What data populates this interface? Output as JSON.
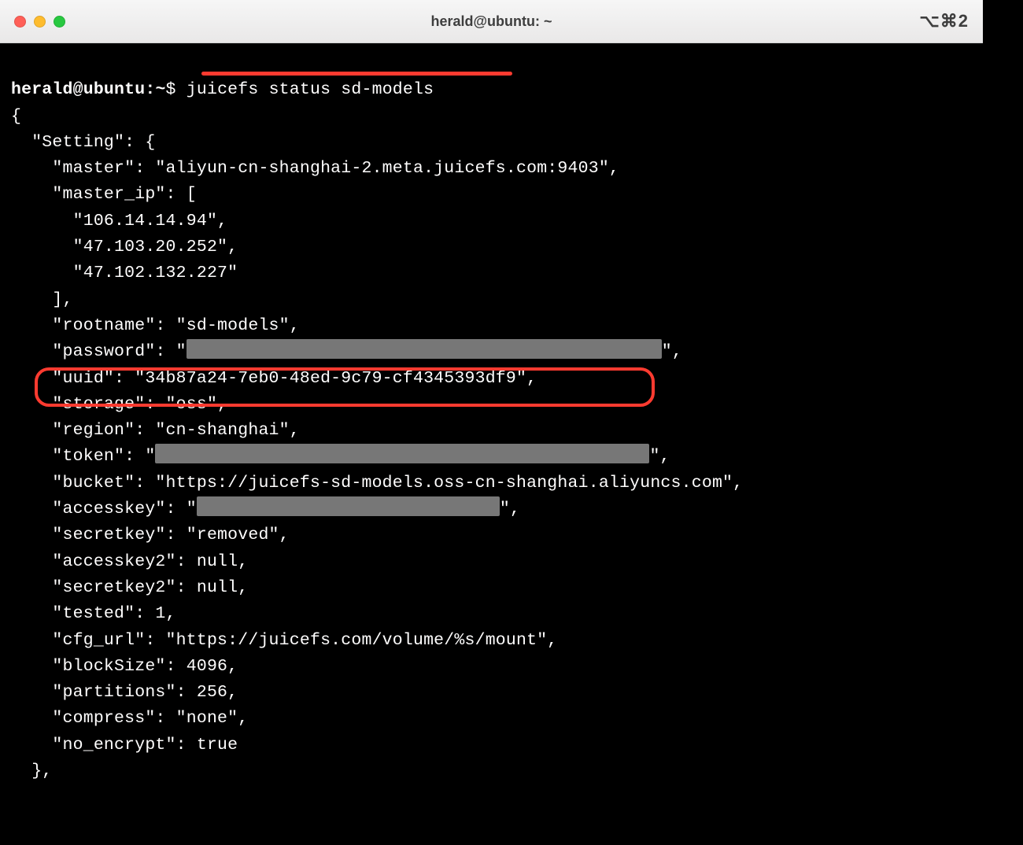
{
  "window": {
    "title": "herald@ubuntu: ~",
    "shortcut": "⌥⌘2"
  },
  "prompt": {
    "user_host": "herald@ubuntu",
    "sep1": ":",
    "cwd": "~",
    "sep2": "$",
    "command": "juicefs status sd-models"
  },
  "l": {
    "brace_open": "{",
    "setting_key": "  \"Setting\": {",
    "master": "    \"master\": \"aliyun-cn-shanghai-2.meta.juicefs.com:9403\",",
    "master_ip_open": "    \"master_ip\": [",
    "ip1": "      \"106.14.14.94\",",
    "ip2": "      \"47.103.20.252\",",
    "ip3": "      \"47.102.132.227\"",
    "master_ip_close": "    ],",
    "rootname": "    \"rootname\": \"sd-models\",",
    "password_pre": "    \"password\": \"",
    "password_post": "\",",
    "uuid": "    \"uuid\": \"34b87a24-7eb0-48ed-9c79-cf4345393df9\",",
    "storage": "    \"storage\": \"oss\",",
    "region": "    \"region\": \"cn-shanghai\",",
    "token_pre": "    \"token\": \"",
    "token_post": "\",",
    "bucket": "    \"bucket\": \"https://juicefs-sd-models.oss-cn-shanghai.aliyuncs.com\",",
    "accesskey_pre": "    \"accesskey\": \"",
    "accesskey_post": "\",",
    "secretkey": "    \"secretkey\": \"removed\",",
    "accesskey2": "    \"accesskey2\": null,",
    "secretkey2": "    \"secretkey2\": null,",
    "tested": "    \"tested\": 1,",
    "cfg_url": "    \"cfg_url\": \"https://juicefs.com/volume/%s/mount\",",
    "blocksize": "    \"blockSize\": 4096,",
    "partitions": "    \"partitions\": 256,",
    "compress": "    \"compress\": \"none\",",
    "no_encrypt": "    \"no_encrypt\": true",
    "brace_close_inner": "  },"
  }
}
